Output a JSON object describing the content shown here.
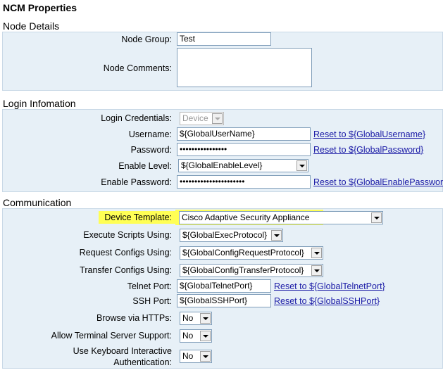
{
  "page_title": "NCM Properties",
  "node_details": {
    "heading": "Node Details",
    "node_group_label": "Node Group:",
    "node_group_value": "Test",
    "node_comments_label": "Node Comments:"
  },
  "login": {
    "heading": "Login Infomation",
    "credentials_label": "Login Credentials:",
    "credentials_value": "Device",
    "username_label": "Username:",
    "username_value": "${GlobalUserName}",
    "username_reset": "Reset to ${GlobalUsername}",
    "password_label": "Password:",
    "password_value": "••••••••••••••••",
    "password_reset": "Reset to ${GlobalPassword}",
    "enable_level_label": "Enable Level:",
    "enable_level_value": "${GlobalEnableLevel}",
    "enable_password_label": "Enable Password:",
    "enable_password_value": "••••••••••••••••••••••",
    "enable_password_reset": "Reset to ${GlobalEnablePassword}"
  },
  "communication": {
    "heading": "Communication",
    "device_template_label": "Device Template:",
    "device_template_value": "Cisco Adaptive Security Appliance",
    "exec_scripts_label": "Execute Scripts Using:",
    "exec_scripts_value": "${GlobalExecProtocol}",
    "request_configs_label": "Request Configs Using:",
    "request_configs_value": "${GlobalConfigRequestProtocol}",
    "transfer_configs_label": "Transfer Configs Using:",
    "transfer_configs_value": "${GlobalConfigTransferProtocol}",
    "telnet_port_label": "Telnet Port:",
    "telnet_port_value": "${GlobalTelnetPort}",
    "telnet_port_reset": "Reset to ${GlobalTelnetPort}",
    "ssh_port_label": "SSH Port:",
    "ssh_port_value": "${GlobalSSHPort}",
    "ssh_port_reset": "Reset to ${GlobalSSHPort}",
    "browse_https_label": "Browse via HTTPs:",
    "browse_https_value": "No",
    "terminal_server_label": "Allow Terminal Server Support:",
    "terminal_server_value": "No",
    "keyboard_auth_label_1": "Use Keyboard Interactive",
    "keyboard_auth_label_2": "Authentication:",
    "keyboard_auth_value": "No"
  },
  "colors": {
    "panel_bg": "#e7f0f7",
    "highlight": "#ffff55",
    "link": "#1a1aa6"
  }
}
